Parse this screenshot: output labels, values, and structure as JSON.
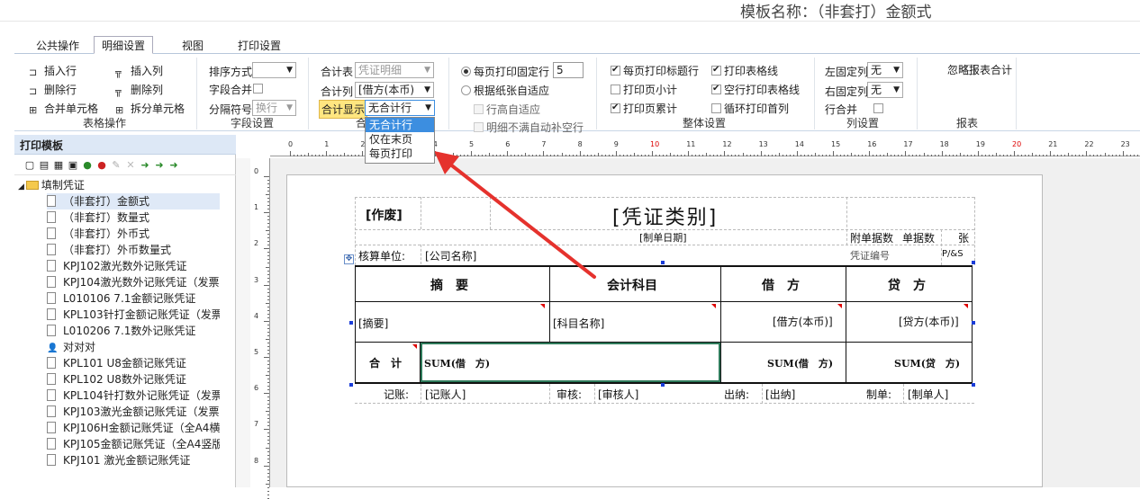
{
  "header": {
    "template_title": "模板名称：（非套打）金额式"
  },
  "tabs": [
    "公共操作",
    "明细设置",
    "视图",
    "打印设置"
  ],
  "ribbon": {
    "table_ops": {
      "insert_row": "插入行",
      "insert_col": "插入列",
      "delete_row": "删除行",
      "delete_col": "删除列",
      "merge_cell": "合并单元格",
      "split_cell": "拆分单元格",
      "group_label": "表格操作"
    },
    "field_settings": {
      "sort_label": "排序方式",
      "sort_value": "",
      "field_merge_label": "字段合并",
      "sep_label": "分隔符号",
      "sep_value": "换行",
      "group_label": "字段设置"
    },
    "total": {
      "table_label": "合计表",
      "table_value": "凭证明细",
      "col_label": "合计列",
      "col_value": "[借方(本币)",
      "show_label": "合计显示",
      "show_value": "无合计行",
      "group_label": "合"
    },
    "print_rows": {
      "fixed_rows_label": "每页打印固定行",
      "fixed_rows_value": "5",
      "adapt_label": "根据纸张自适应",
      "row_adapt_label": "行高自适应",
      "fill_label": "明细不满自动补空行"
    },
    "overall": {
      "print_title": "每页打印标题行",
      "print_grid": "打印表格线",
      "page_subtotal": "打印页小计",
      "empty_grid": "空行打印表格线",
      "page_cumulative": "打印页累计",
      "loop_first": "循环打印首列",
      "group_label": "整体设置"
    },
    "columns": {
      "left_fixed_label": "左固定列",
      "left_fixed_value": "无",
      "right_fixed_label": "右固定列",
      "right_fixed_value": "无",
      "row_merge_label": "行合并",
      "group_label": "列设置"
    },
    "report": {
      "ignore_total": "忽略报表合计",
      "group_label": "报表"
    }
  },
  "dropdown_options": [
    "无合计行",
    "仅在末页",
    "每页打印"
  ],
  "left_panel": {
    "title": "打印模板",
    "root": "填制凭证",
    "items": [
      "（非套打）金额式",
      "（非套打）数量式",
      "（非套打）外币式",
      "（非套打）外币数量式",
      "KPJ102激光数外记账凭证",
      "KPJ104激光数外记账凭证（发票",
      "L010106 7.1金额记账凭证",
      "KPL103针打金额记账凭证（发票",
      "L010206 7.1数外记账凭证",
      "对对对",
      "KPL101 U8金额记账凭证",
      "KPL102 U8数外记账凭证",
      "KPL104针打数外记账凭证（发票",
      "KPJ103激光金额记账凭证（发票",
      "KPJ106H金额记账凭证（全A4横",
      "KPJ105金额记账凭证（全A4竖版",
      "KPJ101 激光金额记账凭证"
    ]
  },
  "ruler": {
    "top": [
      "0",
      "1",
      "2",
      "3",
      "4",
      "5",
      "6",
      "7",
      "8",
      "9",
      "10",
      "11",
      "12",
      "13",
      "14",
      "15",
      "16",
      "17",
      "18",
      "19",
      "20",
      "21",
      "22",
      "23"
    ],
    "left": [
      "0",
      "1",
      "2",
      "3",
      "4",
      "5",
      "6",
      "7",
      "8"
    ]
  },
  "voucher": {
    "void": "[作废]",
    "type": "[凭证类别]",
    "date": "[制单日期]",
    "attach_count": "附单据数",
    "attach_count2": "单据数",
    "sheets": "张",
    "unit_label": "核算单位:",
    "company": "[公司名称]",
    "extra1": "凭证编号",
    "extra2": "P/&S",
    "col_summary": "摘　要",
    "col_subject": "会计科目",
    "col_debit": "借　方",
    "col_credit": "贷　方",
    "row_summary": "[摘要]",
    "row_subject": "[科目名称]",
    "row_debit": "[借方(本币)]",
    "row_credit": "[贷方(本币)]",
    "total_label": "合　计",
    "sum_debit1": "SUM(借　方)",
    "sum_debit2": "SUM(借　方)",
    "sum_credit": "SUM(贷　方)",
    "bookkeeper_label": "记账:",
    "bookkeeper": "[记账人]",
    "auditor_label": "审核:",
    "auditor": "[审核人]",
    "cashier_label": "出纳:",
    "cashier": "[出纳]",
    "maker_label": "制单:",
    "maker": "[制单人]"
  },
  "colors": {
    "accent": "#3c8ee0",
    "arrow": "#e5322d",
    "highlight_field": "#ffe680"
  }
}
